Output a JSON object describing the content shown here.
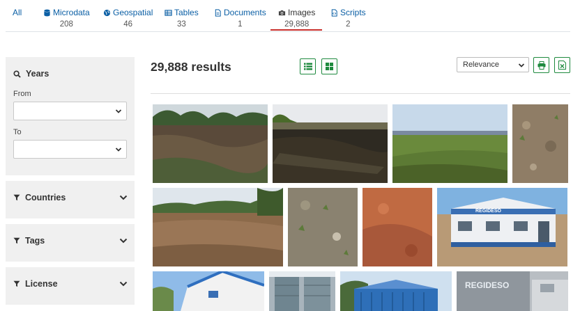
{
  "tabs": [
    {
      "label": "All",
      "count": "",
      "icon": "none"
    },
    {
      "label": "Microdata",
      "count": "208",
      "icon": "database-icon"
    },
    {
      "label": "Geospatial",
      "count": "46",
      "icon": "globe-icon"
    },
    {
      "label": "Tables",
      "count": "33",
      "icon": "table-icon"
    },
    {
      "label": "Documents",
      "count": "1",
      "icon": "document-icon"
    },
    {
      "label": "Images",
      "count": "29,888",
      "icon": "camera-icon",
      "active": true
    },
    {
      "label": "Scripts",
      "count": "2",
      "icon": "script-icon"
    }
  ],
  "sidebar": {
    "years": {
      "title": "Years",
      "from_label": "From",
      "to_label": "To",
      "from_value": "",
      "to_value": ""
    },
    "filters": [
      {
        "title": "Countries"
      },
      {
        "title": "Tags"
      },
      {
        "title": "License"
      }
    ]
  },
  "results": {
    "count_label": "29,888 results",
    "sort_value": "Relevance"
  },
  "colors": {
    "link": "#0b5fa5",
    "accent_green": "#1e8a3e",
    "active_underline": "#c9302c",
    "panel_bg": "#f0f0f0"
  },
  "images": [
    {
      "subject": "field with sparse vegetation"
    },
    {
      "subject": "dark soil field"
    },
    {
      "subject": "green field under sky"
    },
    {
      "subject": "soil close-up"
    },
    {
      "subject": "dry field with trees"
    },
    {
      "subject": "soil with seedlings"
    },
    {
      "subject": "red soil close-up"
    },
    {
      "subject": "REGIDESO building"
    },
    {
      "subject": "building with blue roof"
    },
    {
      "subject": "metal gate"
    },
    {
      "subject": "blue warehouse building"
    },
    {
      "subject": "REGIDESO wall sign"
    }
  ],
  "signs": {
    "regideso": "REGIDESO"
  }
}
